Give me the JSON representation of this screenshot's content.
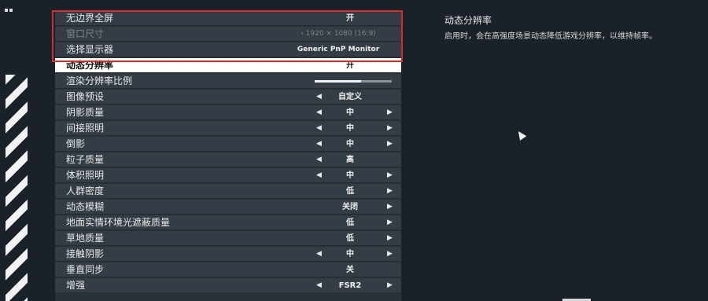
{
  "settings": {
    "rows": [
      {
        "label": "无边界全屏",
        "value": "开"
      },
      {
        "label": "窗口尺寸",
        "value": "‹ 1920 × 1080 (16:9)"
      },
      {
        "label": "选择显示器",
        "value": "Generic PnP Monitor"
      },
      {
        "label": "动态分辨率",
        "value": "开"
      },
      {
        "label": "渲染分辨率比例",
        "slider_value": 0.6
      },
      {
        "label": "图像预设",
        "value": "自定义"
      },
      {
        "label": "阴影质量",
        "value": "中"
      },
      {
        "label": "间接照明",
        "value": "中"
      },
      {
        "label": "倒影",
        "value": "中"
      },
      {
        "label": "粒子质量",
        "value": "高"
      },
      {
        "label": "体积照明",
        "value": "中"
      },
      {
        "label": "人群密度",
        "value": "低"
      },
      {
        "label": "动态模糊",
        "value": "关闭"
      },
      {
        "label": "地面实情环境光遮蔽质量",
        "value": "低"
      },
      {
        "label": "草地质量",
        "value": "低"
      },
      {
        "label": "接触阴影",
        "value": "中"
      },
      {
        "label": "垂直同步",
        "value": "关"
      },
      {
        "label": "增强",
        "value": "FSR2"
      }
    ]
  },
  "description": {
    "title": "动态分辨率",
    "text": "启用时，会在高强度场景动态降低游戏分辨率，以维持帧率。"
  },
  "colors": {
    "highlight": "#d82b2b",
    "background": "#1b2128",
    "row": "#343c45",
    "active_row": "#ffffff"
  }
}
